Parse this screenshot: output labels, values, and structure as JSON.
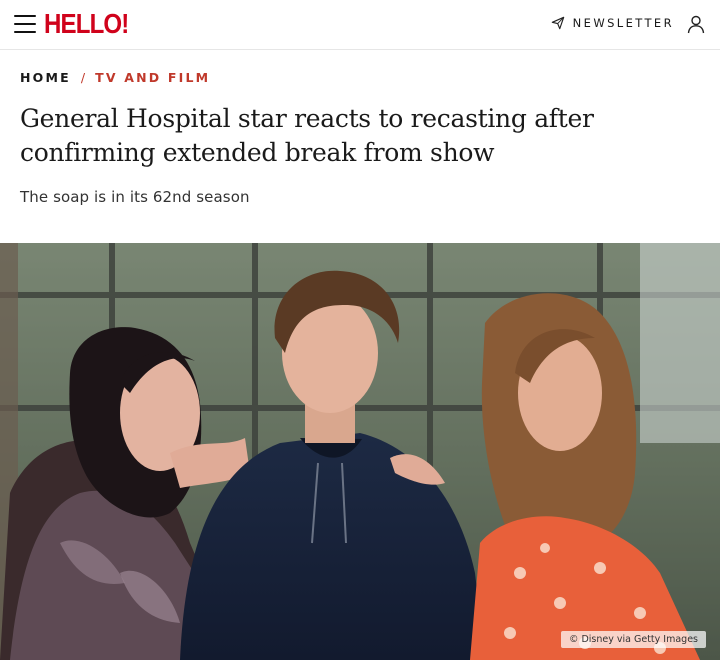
{
  "header": {
    "logo_text": "HELLO!",
    "newsletter_label": "NEWSLETTER",
    "brand_color": "#d0021b"
  },
  "breadcrumb": {
    "home": "HOME",
    "separator": "/",
    "section": "TV AND FILM",
    "accent_color": "#c0392b"
  },
  "article": {
    "headline": "General Hospital star reacts to recasting after confirming extended break from show",
    "standfirst": "The soap is in its 62nd season",
    "image_credit": "© Disney via Getty Images"
  },
  "icons": {
    "menu": "hamburger-menu-icon",
    "newsletter": "paper-plane-icon",
    "account": "user-icon"
  }
}
